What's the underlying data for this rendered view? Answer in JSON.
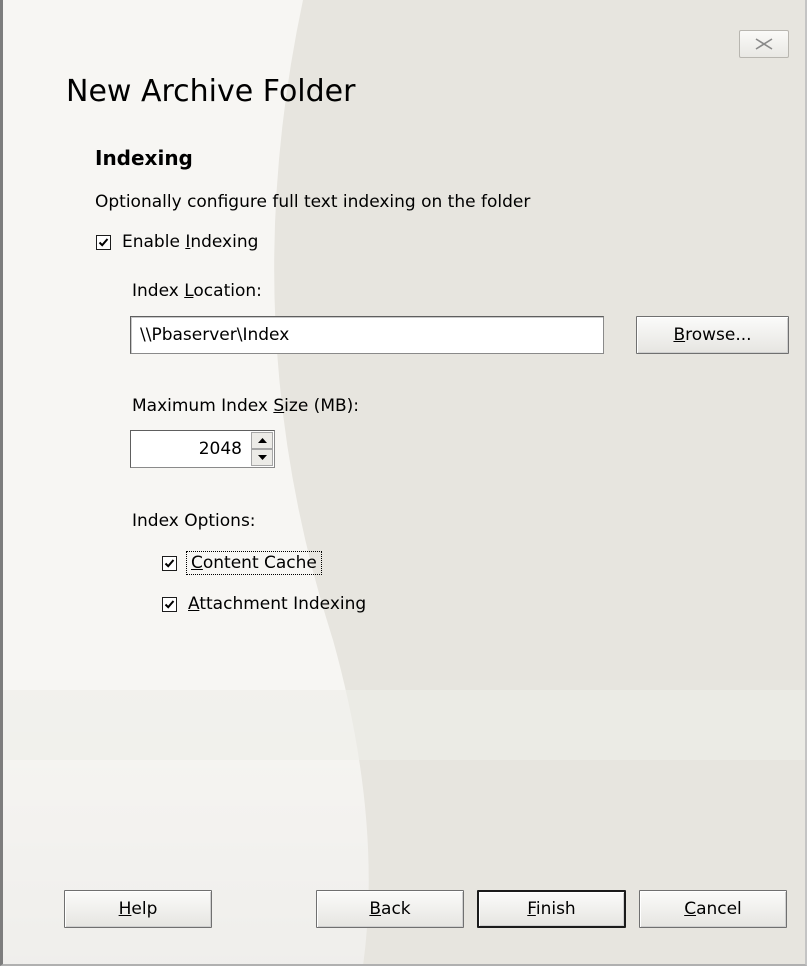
{
  "dialog": {
    "title": "New Archive Folder",
    "close_icon": "close-icon"
  },
  "indexing": {
    "heading": "Indexing",
    "description": "Optionally configure full text indexing on the folder",
    "enable": {
      "label_pre": "Enable ",
      "label_u": "I",
      "label_post": "ndexing",
      "checked": true
    },
    "location": {
      "label_pre": "Index ",
      "label_u": "L",
      "label_post": "ocation:",
      "value": "\\\\Pbaserver\\Index",
      "browse_u": "B",
      "browse_post": "rowse..."
    },
    "max_size": {
      "label_pre": "Maximum Index ",
      "label_u": "S",
      "label_post": "ize (MB):",
      "value": "2048"
    },
    "options": {
      "label": "Index Options:",
      "content_cache": {
        "label_u": "C",
        "label_post": "ontent Cache",
        "checked": true
      },
      "attachment_indexing": {
        "label_u": "A",
        "label_post": "ttachment Indexing",
        "checked": true
      }
    }
  },
  "buttons": {
    "help": {
      "u": "H",
      "post": "elp"
    },
    "back": {
      "u": "B",
      "post": "ack"
    },
    "finish": {
      "u": "F",
      "post": "inish"
    },
    "cancel": {
      "u": "C",
      "post": "ancel"
    }
  },
  "colors": {
    "background": "#f7f6f3",
    "swoosh": "#e5e3dc",
    "border": "#7d7d7d"
  }
}
